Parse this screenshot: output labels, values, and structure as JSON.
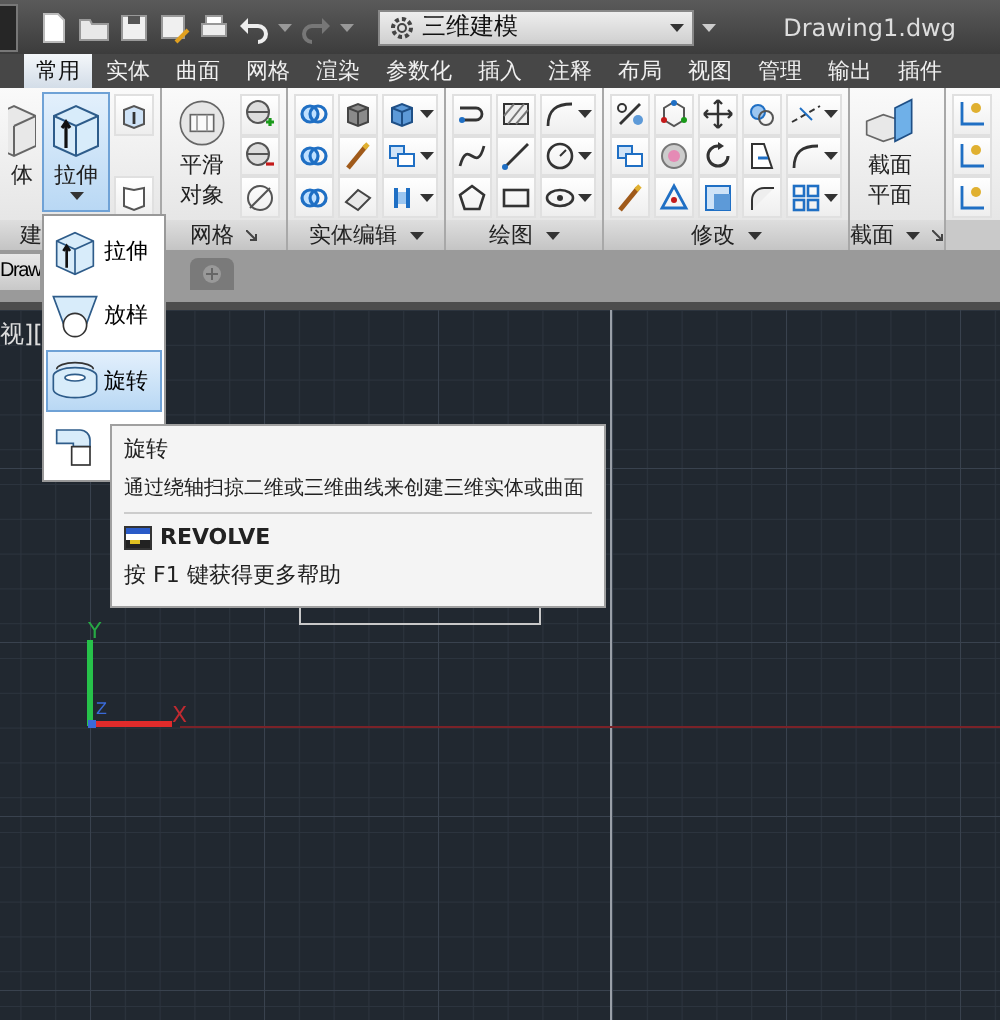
{
  "title_bar": {
    "workspace": "三维建模",
    "file_name": "Drawing1.dwg"
  },
  "tabs": [
    {
      "label": "常用",
      "selected": true
    },
    {
      "label": "实体",
      "selected": false
    },
    {
      "label": "曲面",
      "selected": false
    },
    {
      "label": "网格",
      "selected": false
    },
    {
      "label": "渲染",
      "selected": false
    },
    {
      "label": "参数化",
      "selected": false
    },
    {
      "label": "插入",
      "selected": false
    },
    {
      "label": "注释",
      "selected": false
    },
    {
      "label": "布局",
      "selected": false
    },
    {
      "label": "视图",
      "selected": false
    },
    {
      "label": "管理",
      "selected": false
    },
    {
      "label": "输出",
      "selected": false
    },
    {
      "label": "插件",
      "selected": false
    }
  ],
  "ribbon": {
    "panels": [
      {
        "label": "建",
        "buttons": [
          {
            "label": "体",
            "selected": false
          },
          {
            "label": "拉伸",
            "selected": true
          }
        ]
      },
      {
        "label": "网格",
        "buttons": [
          {
            "label": "平滑对象",
            "selected": false
          }
        ]
      },
      {
        "label": "实体编辑"
      },
      {
        "label": "绘图"
      },
      {
        "label": "修改"
      },
      {
        "label": "截面",
        "buttons": [
          {
            "label": "截面平面",
            "selected": false
          }
        ]
      }
    ]
  },
  "file_tab": "Draw",
  "viewport_label": "视][",
  "ucs": {
    "x_label": "X",
    "y_label": "Y",
    "z_label": "Z"
  },
  "flyout": {
    "items": [
      {
        "label": "拉伸",
        "selected": false
      },
      {
        "label": "放样",
        "selected": false
      },
      {
        "label": "旋转",
        "selected": true
      },
      {
        "selected": false
      }
    ]
  },
  "tooltip": {
    "title": "旋转",
    "description": "通过绕轴扫掠二维或三维曲线来创建三维实体或曲面",
    "command": "REVOLVE",
    "help": "按 F1 键获得更多帮助"
  }
}
